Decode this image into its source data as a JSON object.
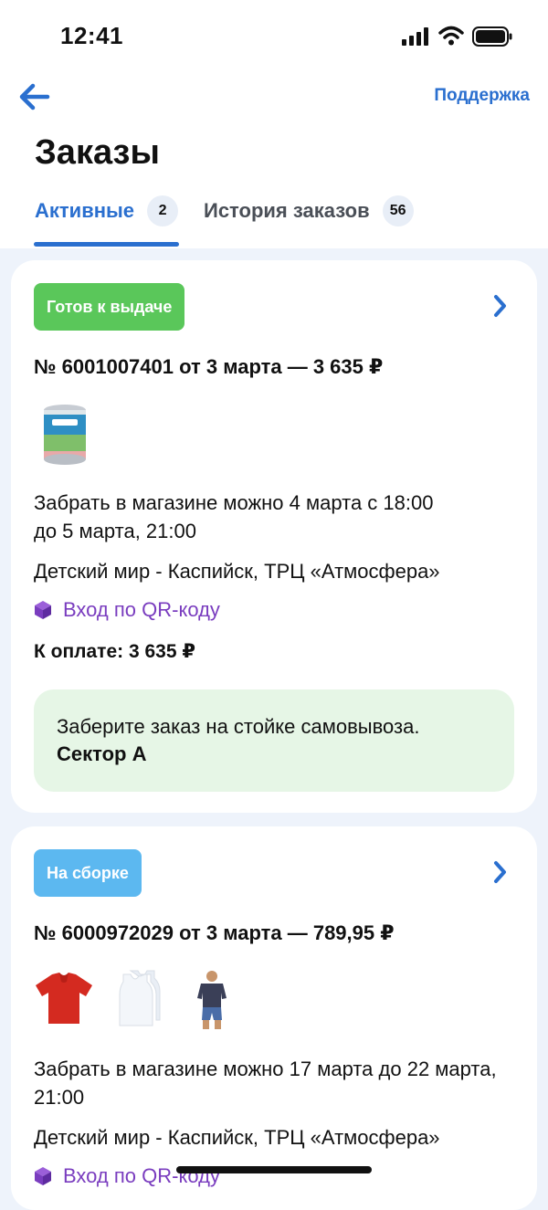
{
  "status_bar": {
    "time": "12:41"
  },
  "header": {
    "support_label": "Поддержка",
    "title": "Заказы"
  },
  "tabs": [
    {
      "label": "Активные",
      "count": "2"
    },
    {
      "label": "История заказов",
      "count": "56"
    }
  ],
  "orders": [
    {
      "status": "Готов к выдаче",
      "status_color": "#5ac75a",
      "title": "№ 6001007401 от 3 марта — 3 635 ₽",
      "pickup_line1": "Забрать в магазине можно 4 марта с 18:00",
      "pickup_line2": "до 5 марта, 21:00",
      "store": "Детский мир - Каспийск, ТРЦ «Атмосфера»",
      "qr_label": "Вход по QR-коду",
      "payment": "К оплате: 3 635 ₽",
      "notice_line1": "Заберите заказ на стойке самовывоза.",
      "notice_line2": "Сектор А"
    },
    {
      "status": "На сборке",
      "status_color": "#5cb8f0",
      "title": "№ 6000972029 от 3 марта — 789,95 ₽",
      "pickup_line1": "Забрать в магазине можно 17 марта до 22 марта,",
      "pickup_line2": "21:00",
      "store": "Детский мир - Каспийск, ТРЦ «Атмосфера»",
      "qr_label": "Вход по QR-коду"
    }
  ],
  "colors": {
    "accent": "#2a6fcf",
    "qr": "#7a3dbf",
    "notice_bg": "#e6f6e6"
  }
}
